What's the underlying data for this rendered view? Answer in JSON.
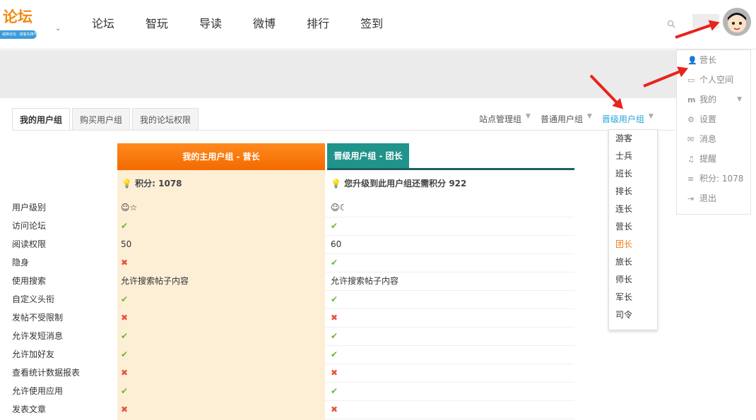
{
  "logo": {
    "text": "论坛",
    "banner": "威锋论坛 · 极客先锋号"
  },
  "nav": [
    "论坛",
    "智玩",
    "导读",
    "微博",
    "排行",
    "签到"
  ],
  "tabs": [
    "我的用户组",
    "购买用户组",
    "我的论坛权限"
  ],
  "filters": [
    "站点管理组",
    "普通用户组",
    "晋级用户组"
  ],
  "dropdown": [
    "游客",
    "士兵",
    "班长",
    "排长",
    "连长",
    "营长",
    "团长",
    "旅长",
    "师长",
    "军长",
    "司令"
  ],
  "user_menu": [
    {
      "label": "营长",
      "icon": "user-icon"
    },
    {
      "label": "个人空间",
      "icon": "card-icon"
    },
    {
      "label": "我的",
      "icon": "m-icon"
    },
    {
      "label": "设置",
      "icon": "gear-icon"
    },
    {
      "label": "消息",
      "icon": "mail-icon"
    },
    {
      "label": "提醒",
      "icon": "bell-icon"
    },
    {
      "label": "积分: 1078",
      "icon": "database-icon"
    },
    {
      "label": "退出",
      "icon": "exit-icon"
    }
  ],
  "groups": {
    "main_title": "我的主用户组 - 营长",
    "next_title": "晋级用户组 - 团长",
    "main_score": "积分: 1078",
    "next_score": "您升级到此用户组还需积分 922"
  },
  "rows": [
    {
      "label": "用户级别",
      "c1": "☺☆",
      "c2": "☺☾"
    },
    {
      "label": "访问论坛",
      "c1": "✔",
      "c2": "✔"
    },
    {
      "label": "阅读权限",
      "c1": "50",
      "c2": "60"
    },
    {
      "label": "隐身",
      "c1": "✖",
      "c2": "✔"
    },
    {
      "label": "使用搜索",
      "c1": "允许搜索帖子内容",
      "c2": "允许搜索帖子内容"
    },
    {
      "label": "自定义头衔",
      "c1": "✔",
      "c2": "✔"
    },
    {
      "label": "发帖不受限制",
      "c1": "✖",
      "c2": "✖"
    },
    {
      "label": "允许发短消息",
      "c1": "✔",
      "c2": "✔"
    },
    {
      "label": "允许加好友",
      "c1": "✔",
      "c2": "✔"
    },
    {
      "label": "查看统计数据报表",
      "c1": "✖",
      "c2": "✖"
    },
    {
      "label": "允许使用应用",
      "c1": "✔",
      "c2": "✔"
    },
    {
      "label": "发表文章",
      "c1": "✖",
      "c2": "✖"
    }
  ]
}
